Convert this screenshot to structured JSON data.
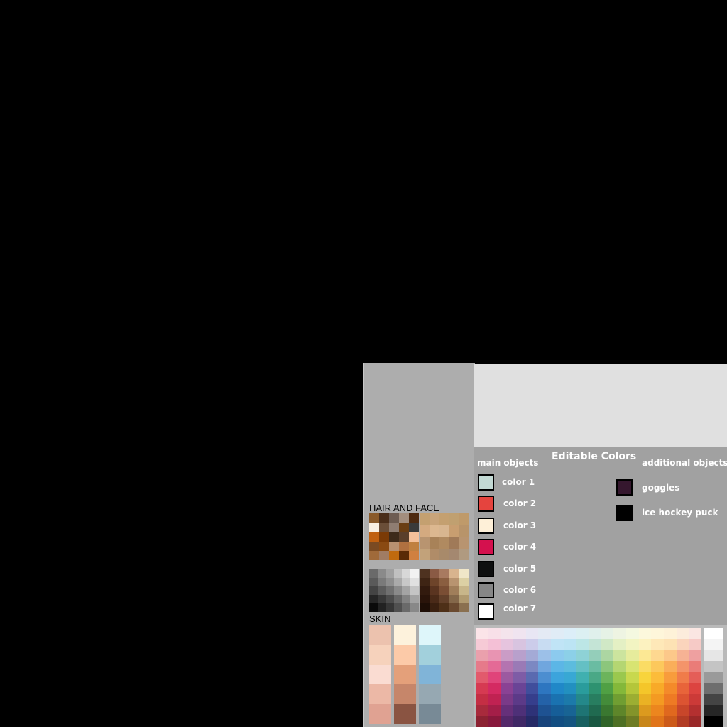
{
  "section_titles": {
    "hair_face": "HAIR AND FACE",
    "skin": "SKIN"
  },
  "editable": {
    "title": "Editable Colors",
    "main_heading": "main objects",
    "additional_heading": "additional objects",
    "main": [
      {
        "label": "color 1",
        "color": "#c3d9d4"
      },
      {
        "label": "color 2",
        "color": "#e5443e"
      },
      {
        "label": "color 3",
        "color": "#fef0d8"
      },
      {
        "label": "color 4",
        "color": "#d4114e"
      },
      {
        "label": "color 5",
        "color": "#0e0f0f"
      },
      {
        "label": "color 6",
        "color": "#868686"
      },
      {
        "label": "color 7",
        "color": "#ffffff"
      }
    ],
    "additional": [
      {
        "label": "goggles",
        "color": "#35172e"
      },
      {
        "label": "ice hockey puck",
        "color": "#000000"
      }
    ]
  },
  "palettes": {
    "hair1": [
      "#8a5a2a",
      "#4a2e1a",
      "#6d5c52",
      "#a38e7e",
      "#4e2a10",
      "#f8efe2",
      "#6a4e38",
      "#8f7d72",
      "#6a3d12",
      "#3a3a3a",
      "#c06010",
      "#7a3a06",
      "#3e2a1a",
      "#5a3e2a",
      "#f4c09a",
      "#7a4a22",
      "#8a4a12",
      "#b89070",
      "#b07040",
      "#c08040",
      "#a06a3a",
      "#a07c64",
      "#c06a0e",
      "#5a2a06",
      "#d08040"
    ],
    "hair2": [
      "#c4a070",
      "#c8a47a",
      "#c4a070",
      "#c0a070",
      "#bf9a6a",
      "#d4aa80",
      "#dcb890",
      "#d8b690",
      "#c89e70",
      "#b8946a",
      "#b89470",
      "#a88258",
      "#b08a60",
      "#a07a58",
      "#b89470",
      "#c2a27a",
      "#b08c68",
      "#a88a6a",
      "#a48870",
      "#b09a80"
    ],
    "gray": [
      "#6a6a6a",
      "#8a8a8a",
      "#a0a0a0",
      "#c0c0c0",
      "#d8d8d8",
      "#f2f2f2",
      "#5a5a5a",
      "#7a7a7a",
      "#8e8e8e",
      "#aaaaaa",
      "#c8c8c8",
      "#e0e0e0",
      "#444444",
      "#5c5c5c",
      "#707070",
      "#8a8a8a",
      "#a4a4a4",
      "#c4c4c4",
      "#262626",
      "#383838",
      "#4c4c4c",
      "#666666",
      "#828282",
      "#a2a2a2",
      "#0a0a0a",
      "#222222",
      "#363636",
      "#505050",
      "#6a6a6a",
      "#888888"
    ],
    "brown": [
      "#4e3220",
      "#8a5a44",
      "#a87a60",
      "#d8b48e",
      "#f0e6c8",
      "#3e2414",
      "#6e442a",
      "#8a5e40",
      "#b89470",
      "#dcd0a4",
      "#321a0e",
      "#5a3420",
      "#7a4e34",
      "#a07e5a",
      "#c8b68a",
      "#2a140a",
      "#4a2a18",
      "#62402a",
      "#84684a",
      "#b09a70",
      "#1e0e06",
      "#3a2010",
      "#4e3018",
      "#6a4a30",
      "#8a7050"
    ],
    "skin": [
      "#ecc2ae",
      "#fdf2dc",
      "#def6fa",
      "#f6d2bc",
      "#fccaa8",
      "#a2d0dc",
      "#fadcd2",
      "#e4a07a",
      "#80b4d8",
      "#ecb8a6",
      "#c6866a",
      "#96a8b2",
      "#e0a292",
      "#8a5442",
      "#788a96"
    ],
    "colors": [
      [
        "#fbe4e8",
        "#f8e0e8",
        "#f4e4ec",
        "#f0e4f0",
        "#e8e6f4",
        "#e4eaf4",
        "#e0ecf6",
        "#dceef8",
        "#dcf0f2",
        "#e0f0ec",
        "#e6f2e6",
        "#eef4e2",
        "#f4f8e0",
        "#fcf8dc",
        "#fef6da",
        "#fef2d8",
        "#fcecdc",
        "#fae6e2"
      ],
      [
        "#f6cad6",
        "#f4c0d6",
        "#e6c4de",
        "#d8c4e0",
        "#ccccea",
        "#c8dcf2",
        "#c0e4f6",
        "#bce4f4",
        "#bce6e6",
        "#c4e4d6",
        "#d0e8c6",
        "#e4f0c4",
        "#f2f4c2",
        "#fcf2c0",
        "#fee8b8",
        "#fde2b4",
        "#fad4bc",
        "#f6cac6"
      ],
      [
        "#eaa0ac",
        "#e894b2",
        "#ca9cc6",
        "#b8a0cc",
        "#a4aad6",
        "#9cc0e8",
        "#8ccaee",
        "#8cd0e8",
        "#8ed2d6",
        "#94ceba",
        "#acd6a2",
        "#cce49e",
        "#e6ec9c",
        "#fce894",
        "#fed890",
        "#fcc88a",
        "#f6b294",
        "#eea0a0"
      ],
      [
        "#e67a8a",
        "#e46a96",
        "#b474b0",
        "#9a7ab6",
        "#7c88c2",
        "#70a6de",
        "#5cb6e6",
        "#5cbcde",
        "#64c0c4",
        "#6abca2",
        "#8cc67c",
        "#b4d672",
        "#d8e472",
        "#fadc64",
        "#fcc85c",
        "#faae5a",
        "#f4946a",
        "#ea7c78"
      ],
      [
        "#e25a6c",
        "#e0447a",
        "#9c5aa0",
        "#7e5ca6",
        "#5a6ab0",
        "#4c8ed0",
        "#3ca4dc",
        "#38a8d4",
        "#40b0b0",
        "#4aa886",
        "#6cb45c",
        "#9ac84e",
        "#c8d84e",
        "#f8d43c",
        "#fcbc3a",
        "#f89c3c",
        "#f07c4a",
        "#e45e58"
      ],
      [
        "#d63a52",
        "#d42a62",
        "#8a4294",
        "#6a4496",
        "#404e9c",
        "#2e76c0",
        "#2088c8",
        "#2290c0",
        "#2a9c9c",
        "#2e9270",
        "#50a044",
        "#84b83a",
        "#b4c63a",
        "#f4c62a",
        "#f8aa28",
        "#f48a2a",
        "#e8643a",
        "#dc4440"
      ],
      [
        "#c42e44",
        "#c02252",
        "#7a3a88",
        "#5c3a88",
        "#363e8c",
        "#2462a8",
        "#1a72b0",
        "#1c7aaa",
        "#24888a",
        "#287e60",
        "#448c3a",
        "#709e32",
        "#9cae32",
        "#eab224",
        "#f49a22",
        "#ee7a24",
        "#dc5432",
        "#cc3a38"
      ],
      [
        "#a82a3c",
        "#a41e48",
        "#66307a",
        "#4e3078",
        "#2e3278",
        "#1e5292",
        "#165e98",
        "#186494",
        "#1e7474",
        "#206a50",
        "#3a7830",
        "#5e862a",
        "#84942a",
        "#dc9a1e",
        "#ec861e",
        "#e0681e",
        "#c8462a",
        "#b43030"
      ],
      [
        "#8c2232",
        "#88183c",
        "#54286a",
        "#402866",
        "#262a66",
        "#18447c",
        "#124e82",
        "#145480",
        "#186060",
        "#1a5842",
        "#306428",
        "#4e7024",
        "#6e7c24",
        "#c8861a",
        "#e0741a",
        "#cc5a1a",
        "#b23c24",
        "#9a2828"
      ]
    ],
    "grays_col": [
      "#ffffff",
      "#f4f4f4",
      "#e6e6e6",
      "#c4c4c4",
      "#9a9a9a",
      "#6e6e6e",
      "#444444",
      "#262626",
      "#000000"
    ]
  }
}
